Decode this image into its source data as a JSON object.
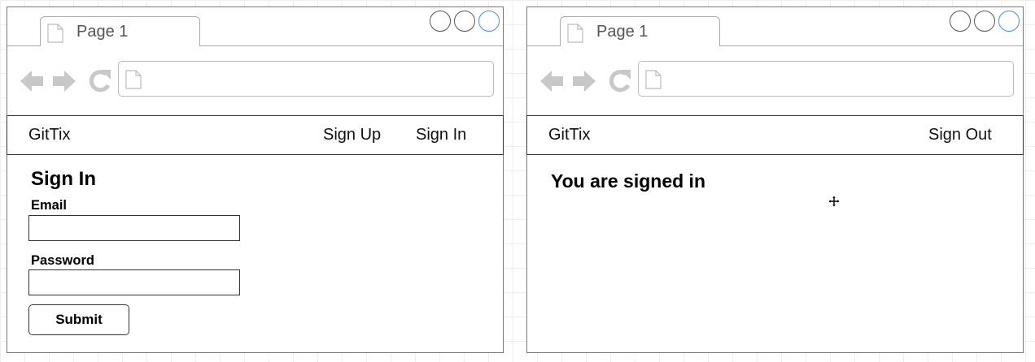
{
  "left_browser": {
    "tab_title": "Page 1",
    "app_nav": {
      "brand": "GitTix",
      "links": [
        "Sign Up",
        "Sign In"
      ]
    },
    "form": {
      "heading": "Sign In",
      "email_label": "Email",
      "email_value": "",
      "password_label": "Password",
      "password_value": "",
      "submit_label": "Submit"
    }
  },
  "right_browser": {
    "tab_title": "Page 1",
    "app_nav": {
      "brand": "GitTix",
      "links": [
        "Sign Out"
      ]
    },
    "message": "You are signed in"
  },
  "colors": {
    "window_button_accent": "#4a90d9",
    "chrome_icons": "#c8c8c8",
    "outline": "#333333"
  },
  "icons": [
    "page-icon",
    "back-arrow-icon",
    "forward-arrow-icon",
    "reload-icon",
    "move-cursor-icon"
  ]
}
